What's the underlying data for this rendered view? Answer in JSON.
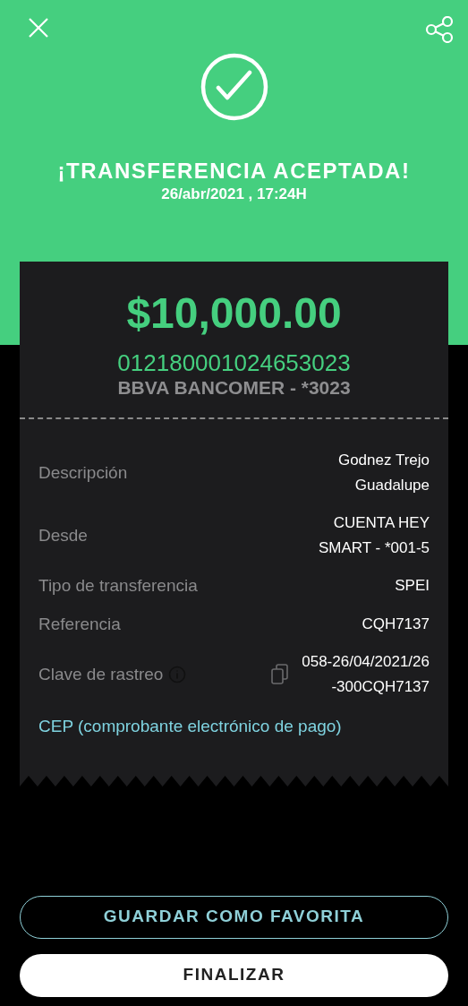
{
  "header": {
    "title": "¡TRANSFERENCIA ACEPTADA!",
    "datetime": "26/abr/2021 , 17:24H"
  },
  "receipt": {
    "amount": "$10,000.00",
    "account": "012180001024653023",
    "bank": "BBVA BANCOMER - *3023",
    "rows": [
      {
        "label": "Descripción",
        "value_lines": [
          "Godnez Trejo",
          "Guadalupe"
        ]
      },
      {
        "label": "Desde",
        "value_lines": [
          "CUENTA HEY",
          "SMART - *001-5"
        ]
      },
      {
        "label": "Tipo de transferencia",
        "value_lines": [
          "SPEI"
        ]
      },
      {
        "label": "Referencia",
        "value_lines": [
          "CQH7137"
        ]
      },
      {
        "label": "Clave de rastreo",
        "value_lines": [
          "058-26/04/2021/26",
          "-300CQH7137"
        ],
        "info": true,
        "copyable": true
      }
    ],
    "link": "CEP (comprobante electrónico de pago)"
  },
  "buttons": [
    {
      "label": "GUARDAR COMO FAVORITA",
      "kind": "outline"
    },
    {
      "label": "FINALIZAR",
      "kind": "filled"
    }
  ]
}
